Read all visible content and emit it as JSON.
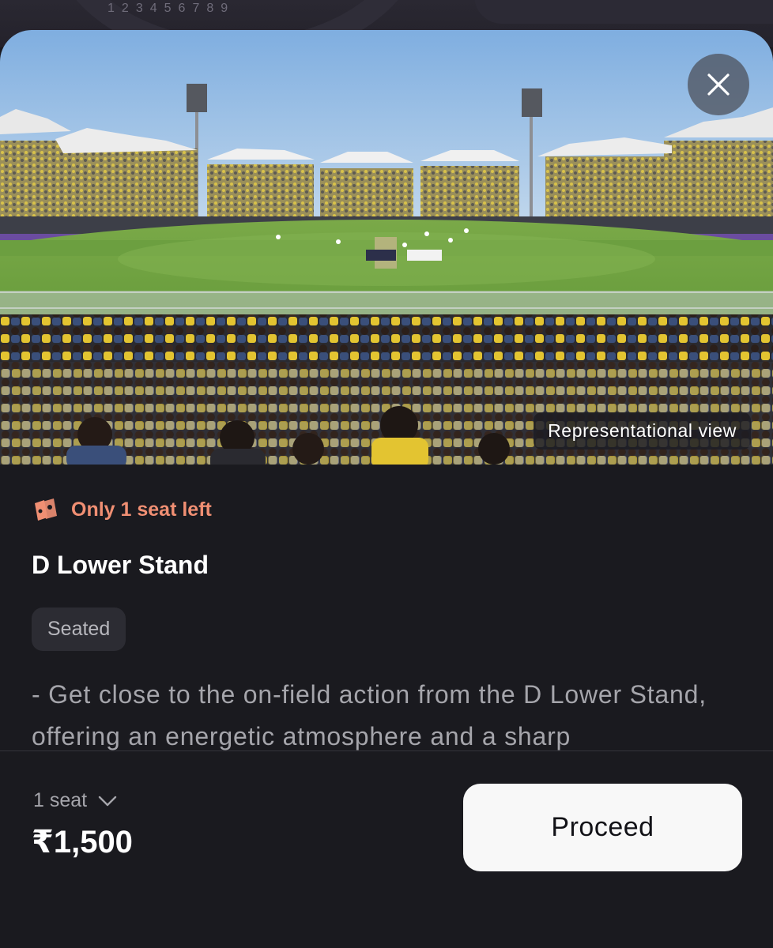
{
  "background": {
    "numbers": [
      "1",
      "2",
      "3",
      "4",
      "5",
      "6",
      "7",
      "8",
      "9"
    ]
  },
  "hero": {
    "badge": "Representational view",
    "close_icon": "close-icon"
  },
  "listing": {
    "scarcity_text": "Only 1 seat left",
    "scarcity_icon": "ticket-icon",
    "stand_name": "D Lower Stand",
    "seating_type": "Seated",
    "description": "- Get close to the on-field action from the D Lower Stand, offering an energetic atmosphere and a sharp"
  },
  "footer": {
    "seat_count": "1 seat",
    "seat_icon": "chevron-down-icon",
    "price": "₹1,500",
    "proceed_label": "Proceed"
  },
  "colors": {
    "accent_scarcity": "#f08f73",
    "sheet_bg": "#1a1a1f",
    "button_bg": "#f8f8f8"
  }
}
